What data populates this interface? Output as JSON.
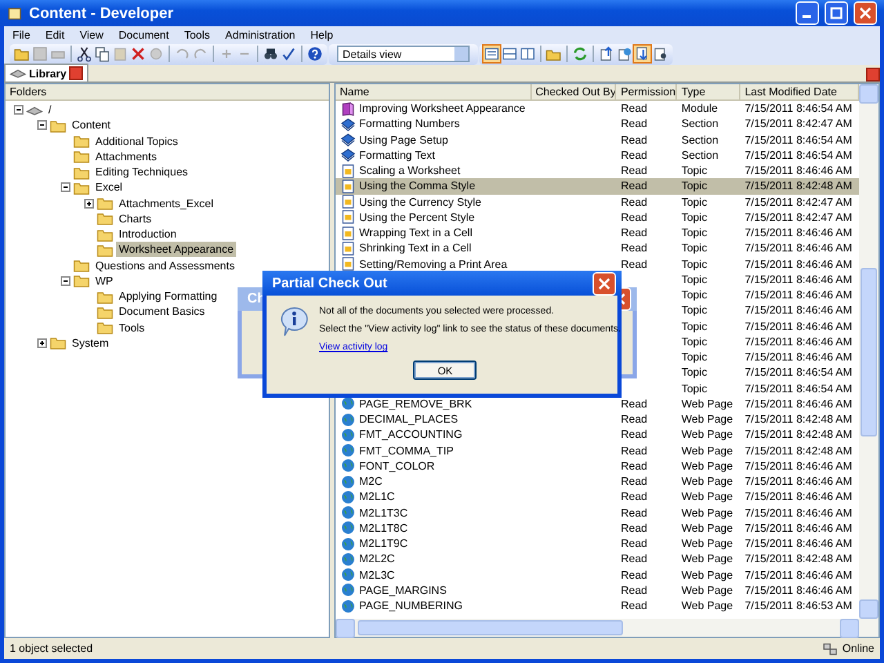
{
  "window": {
    "title": "Content - Developer"
  },
  "menu": [
    {
      "label": "File"
    },
    {
      "label": "Edit"
    },
    {
      "label": "View"
    },
    {
      "label": "Document"
    },
    {
      "label": "Tools"
    },
    {
      "label": "Administration"
    },
    {
      "label": "Help"
    }
  ],
  "toolbar": {
    "view_select": {
      "value": "Details view"
    }
  },
  "tabs": [
    {
      "label": "Library",
      "selected": true
    }
  ],
  "folders": {
    "title": "Folders",
    "tree": [
      {
        "label": "/",
        "kind": "root",
        "expanded": true,
        "selected": false,
        "children": [
          {
            "label": "Content",
            "expanded": true,
            "selected": false,
            "children": [
              {
                "label": "Additional Topics",
                "selected": false
              },
              {
                "label": "Attachments",
                "selected": false
              },
              {
                "label": "Editing Techniques",
                "selected": false
              },
              {
                "label": "Excel",
                "expanded": true,
                "selected": false,
                "children": [
                  {
                    "label": "Attachments_Excel",
                    "expanded": false,
                    "selected": false
                  },
                  {
                    "label": "Charts",
                    "selected": false
                  },
                  {
                    "label": "Introduction",
                    "selected": false
                  },
                  {
                    "label": "Worksheet Appearance",
                    "selected": true
                  }
                ]
              },
              {
                "label": "Questions and Assessments",
                "selected": false
              },
              {
                "label": "WP",
                "expanded": true,
                "selected": false,
                "children": [
                  {
                    "label": "Applying Formatting",
                    "selected": false
                  },
                  {
                    "label": "Document Basics",
                    "selected": false
                  },
                  {
                    "label": "Tools",
                    "selected": false
                  }
                ]
              }
            ]
          },
          {
            "label": "System",
            "expanded": false,
            "selected": false
          }
        ]
      }
    ]
  },
  "table": {
    "columns": [
      "Name",
      "Checked Out By",
      "Permission",
      "Type",
      "Last Modified Date"
    ],
    "rows": [
      {
        "kind": "module",
        "name": "Improving Worksheet Appearance",
        "permission": "Read",
        "type": "Module",
        "date": "7/15/2011 8:46:54 AM",
        "selected": false
      },
      {
        "kind": "section",
        "name": "Formatting Numbers",
        "permission": "Read",
        "type": "Section",
        "date": "7/15/2011 8:42:47 AM",
        "selected": false
      },
      {
        "kind": "section",
        "name": "Using Page Setup",
        "permission": "Read",
        "type": "Section",
        "date": "7/15/2011 8:46:54 AM",
        "selected": false
      },
      {
        "kind": "section",
        "name": "Formatting Text",
        "permission": "Read",
        "type": "Section",
        "date": "7/15/2011 8:46:54 AM",
        "selected": false
      },
      {
        "kind": "topic",
        "name": "Scaling a Worksheet",
        "permission": "Read",
        "type": "Topic",
        "date": "7/15/2011 8:46:46 AM",
        "selected": false
      },
      {
        "kind": "topic",
        "name": "Using the Comma Style",
        "permission": "Read",
        "type": "Topic",
        "date": "7/15/2011 8:42:48 AM",
        "selected": true
      },
      {
        "kind": "topic",
        "name": "Using the Currency Style",
        "permission": "Read",
        "type": "Topic",
        "date": "7/15/2011 8:42:47 AM",
        "selected": false
      },
      {
        "kind": "topic",
        "name": "Using the Percent Style",
        "permission": "Read",
        "type": "Topic",
        "date": "7/15/2011 8:42:47 AM",
        "selected": false
      },
      {
        "kind": "topic",
        "name": "Wrapping Text in a Cell",
        "permission": "Read",
        "type": "Topic",
        "date": "7/15/2011 8:46:46 AM",
        "selected": false
      },
      {
        "kind": "topic",
        "name": "Shrinking Text in a Cell",
        "permission": "Read",
        "type": "Topic",
        "date": "7/15/2011 8:46:46 AM",
        "selected": false
      },
      {
        "kind": "topic",
        "name": "Setting/Removing a Print Area",
        "permission": "Read",
        "type": "Topic",
        "date": "7/15/2011 8:46:46 AM",
        "selected": false
      },
      {
        "type": "Topic",
        "date": "7/15/2011 8:46:46 AM",
        "selected": false
      },
      {
        "type": "Topic",
        "date": "7/15/2011 8:46:46 AM",
        "selected": false
      },
      {
        "type": "Topic",
        "date": "7/15/2011 8:46:46 AM",
        "selected": false
      },
      {
        "type": "Topic",
        "date": "7/15/2011 8:46:46 AM",
        "selected": false
      },
      {
        "type": "Topic",
        "date": "7/15/2011 8:46:46 AM",
        "selected": false
      },
      {
        "type": "Topic",
        "date": "7/15/2011 8:46:46 AM",
        "selected": false
      },
      {
        "type": "Topic",
        "date": "7/15/2011 8:46:54 AM",
        "selected": false
      },
      {
        "type": "Topic",
        "date": "7/15/2011 8:46:54 AM",
        "selected": false
      },
      {
        "kind": "webpage",
        "name": "PAGE_REMOVE_BRK",
        "permission": "Read",
        "type": "Web Page",
        "date": "7/15/2011 8:46:46 AM",
        "selected": false
      },
      {
        "kind": "webpage",
        "name": "DECIMAL_PLACES",
        "permission": "Read",
        "type": "Web Page",
        "date": "7/15/2011 8:42:48 AM",
        "selected": false
      },
      {
        "kind": "webpage",
        "name": "FMT_ACCOUNTING",
        "permission": "Read",
        "type": "Web Page",
        "date": "7/15/2011 8:42:48 AM",
        "selected": false
      },
      {
        "kind": "webpage",
        "name": "FMT_COMMA_TIP",
        "permission": "Read",
        "type": "Web Page",
        "date": "7/15/2011 8:42:48 AM",
        "selected": false
      },
      {
        "kind": "webpage",
        "name": "FONT_COLOR",
        "permission": "Read",
        "type": "Web Page",
        "date": "7/15/2011 8:46:46 AM",
        "selected": false
      },
      {
        "kind": "webpage",
        "name": "M2C",
        "permission": "Read",
        "type": "Web Page",
        "date": "7/15/2011 8:46:46 AM",
        "selected": false
      },
      {
        "kind": "webpage",
        "name": "M2L1C",
        "permission": "Read",
        "type": "Web Page",
        "date": "7/15/2011 8:46:46 AM",
        "selected": false
      },
      {
        "kind": "webpage",
        "name": "M2L1T3C",
        "permission": "Read",
        "type": "Web Page",
        "date": "7/15/2011 8:46:46 AM",
        "selected": false
      },
      {
        "kind": "webpage",
        "name": "M2L1T8C",
        "permission": "Read",
        "type": "Web Page",
        "date": "7/15/2011 8:46:46 AM",
        "selected": false
      },
      {
        "kind": "webpage",
        "name": "M2L1T9C",
        "permission": "Read",
        "type": "Web Page",
        "date": "7/15/2011 8:46:46 AM",
        "selected": false
      },
      {
        "kind": "webpage",
        "name": "M2L2C",
        "permission": "Read",
        "type": "Web Page",
        "date": "7/15/2011 8:42:48 AM",
        "selected": false
      },
      {
        "kind": "webpage",
        "name": "M2L3C",
        "permission": "Read",
        "type": "Web Page",
        "date": "7/15/2011 8:46:46 AM",
        "selected": false
      },
      {
        "kind": "webpage",
        "name": "PAGE_MARGINS",
        "permission": "Read",
        "type": "Web Page",
        "date": "7/15/2011 8:46:46 AM",
        "selected": false
      },
      {
        "kind": "webpage",
        "name": "PAGE_NUMBERING",
        "permission": "Read",
        "type": "Web Page",
        "date": "7/15/2011 8:46:53 AM",
        "selected": false
      }
    ]
  },
  "status_bar": {
    "message": "1 object selected",
    "connection": "Online"
  },
  "back_dialog": {
    "title": "Ch"
  },
  "dialog": {
    "title": "Partial Check Out",
    "message": "Not all of the documents you selected were processed.",
    "hint": "Select the \"View activity log\" link to see the status of these documents.",
    "link": "View activity log",
    "button": "OK"
  }
}
